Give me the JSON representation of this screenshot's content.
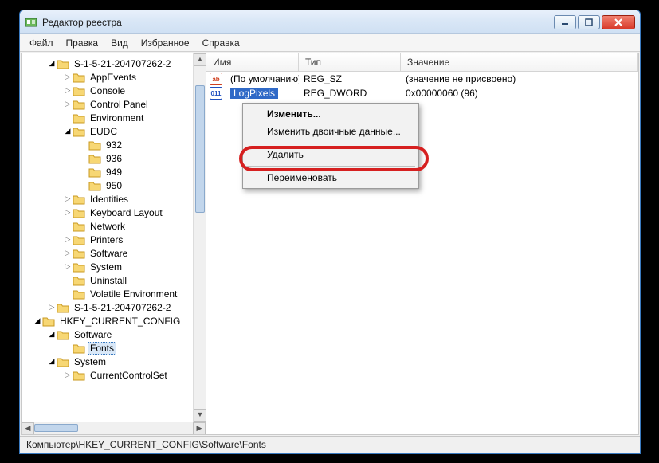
{
  "window": {
    "title": "Редактор реестра"
  },
  "menu": {
    "file": "Файл",
    "edit": "Правка",
    "view": "Вид",
    "fav": "Избранное",
    "help": "Справка"
  },
  "tree": {
    "sid1": "S-1-5-21-204707262-2",
    "appEvents": "AppEvents",
    "console": "Console",
    "controlPanel": "Control Panel",
    "environment": "Environment",
    "eudc": "EUDC",
    "e932": "932",
    "e936": "936",
    "e949": "949",
    "e950": "950",
    "identities": "Identities",
    "keyboard": "Keyboard Layout",
    "network": "Network",
    "printers": "Printers",
    "software": "Software",
    "system": "System",
    "uninstall": "Uninstall",
    "volatile": "Volatile Environment",
    "sid2": "S-1-5-21-204707262-2",
    "hkcc": "HKEY_CURRENT_CONFIG",
    "softwareNode": "Software",
    "fonts": "Fonts",
    "systemNode": "System",
    "ccs": "CurrentControlSet"
  },
  "list": {
    "colName": "Имя",
    "colType": "Тип",
    "colValue": "Значение",
    "row0": {
      "name": "(По умолчанию)",
      "type": "REG_SZ",
      "value": "(значение не присвоено)"
    },
    "row1": {
      "name": "LogPixels",
      "type": "REG_DWORD",
      "value": "0x00000060 (96)"
    }
  },
  "ctx": {
    "modify": "Изменить...",
    "modifyBin": "Изменить двоичные данные...",
    "delete": "Удалить",
    "rename": "Переименовать"
  },
  "status": {
    "path": "Компьютер\\HKEY_CURRENT_CONFIG\\Software\\Fonts"
  }
}
